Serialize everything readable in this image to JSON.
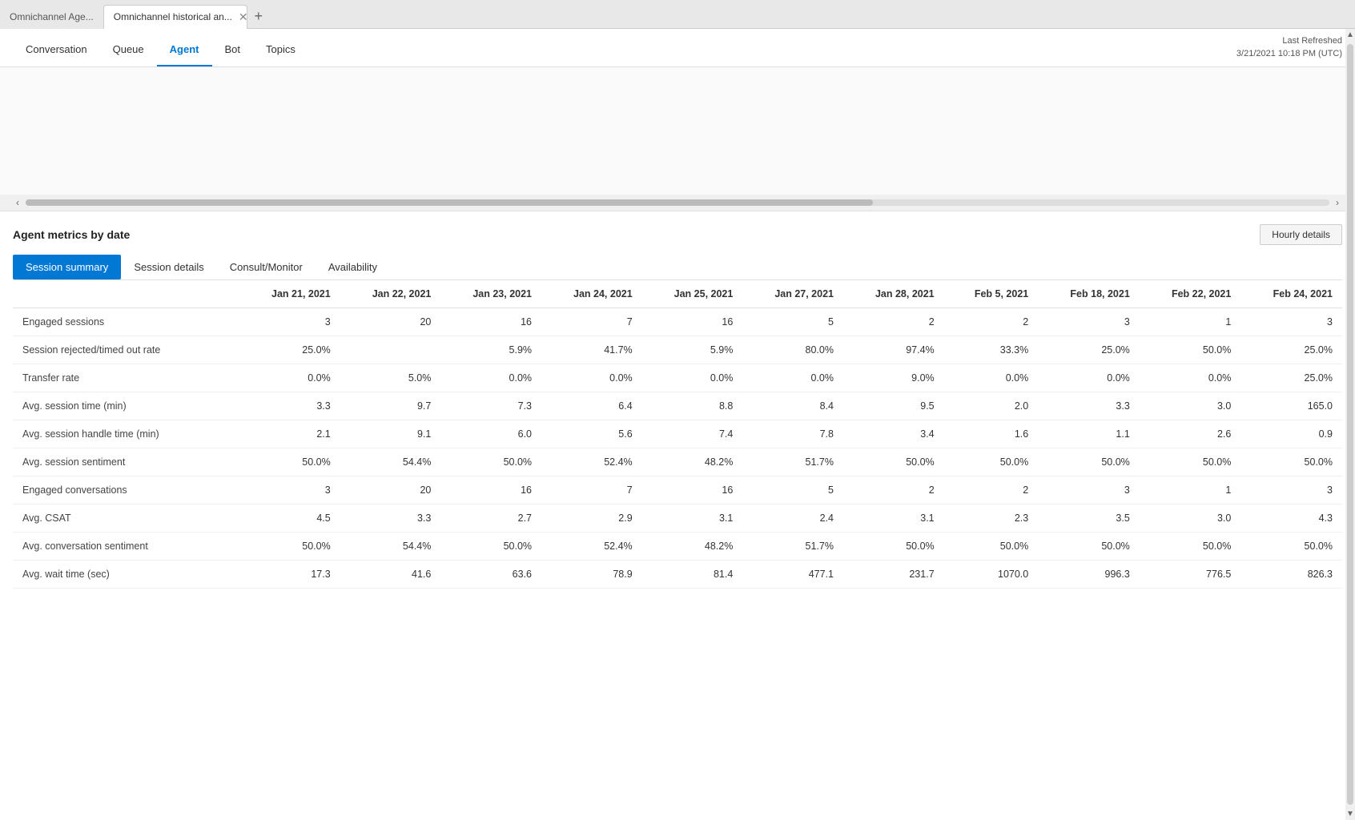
{
  "browser": {
    "tabs": [
      {
        "id": "tab1",
        "label": "Omnichannel Age...",
        "active": false
      },
      {
        "id": "tab2",
        "label": "Omnichannel historical an...",
        "active": true
      }
    ],
    "add_tab_label": "+"
  },
  "nav": {
    "items": [
      {
        "id": "conversation",
        "label": "Conversation",
        "active": false
      },
      {
        "id": "queue",
        "label": "Queue",
        "active": false
      },
      {
        "id": "agent",
        "label": "Agent",
        "active": true
      },
      {
        "id": "bot",
        "label": "Bot",
        "active": false
      },
      {
        "id": "topics",
        "label": "Topics",
        "active": false
      }
    ],
    "last_refreshed_label": "Last Refreshed",
    "last_refreshed_value": "3/21/2021 10:18 PM (UTC)"
  },
  "section": {
    "title": "Agent metrics by date",
    "hourly_details_button": "Hourly details",
    "sub_tabs": [
      {
        "id": "session-summary",
        "label": "Session summary",
        "active": true
      },
      {
        "id": "session-details",
        "label": "Session details",
        "active": false
      },
      {
        "id": "consult-monitor",
        "label": "Consult/Monitor",
        "active": false
      },
      {
        "id": "availability",
        "label": "Availability",
        "active": false
      }
    ]
  },
  "table": {
    "columns": [
      "",
      "Jan 21, 2021",
      "Jan 22, 2021",
      "Jan 23, 2021",
      "Jan 24, 2021",
      "Jan 25, 2021",
      "Jan 27, 2021",
      "Jan 28, 2021",
      "Feb 5, 2021",
      "Feb 18, 2021",
      "Feb 22, 2021",
      "Feb 24, 2021"
    ],
    "rows": [
      {
        "label": "Engaged sessions",
        "values": [
          "3",
          "20",
          "16",
          "7",
          "16",
          "5",
          "2",
          "2",
          "3",
          "1",
          "3"
        ]
      },
      {
        "label": "Session rejected/timed out rate",
        "values": [
          "25.0%",
          "",
          "5.9%",
          "41.7%",
          "5.9%",
          "80.0%",
          "97.4%",
          "33.3%",
          "25.0%",
          "50.0%",
          "25.0%"
        ]
      },
      {
        "label": "Transfer rate",
        "values": [
          "0.0%",
          "5.0%",
          "0.0%",
          "0.0%",
          "0.0%",
          "0.0%",
          "9.0%",
          "0.0%",
          "0.0%",
          "0.0%",
          "25.0%"
        ]
      },
      {
        "label": "Avg. session time (min)",
        "values": [
          "3.3",
          "9.7",
          "7.3",
          "6.4",
          "8.8",
          "8.4",
          "9.5",
          "2.0",
          "3.3",
          "3.0",
          "165.0"
        ]
      },
      {
        "label": "Avg. session handle time (min)",
        "values": [
          "2.1",
          "9.1",
          "6.0",
          "5.6",
          "7.4",
          "7.8",
          "3.4",
          "1.6",
          "1.1",
          "2.6",
          "0.9"
        ]
      },
      {
        "label": "Avg. session sentiment",
        "values": [
          "50.0%",
          "54.4%",
          "50.0%",
          "52.4%",
          "48.2%",
          "51.7%",
          "50.0%",
          "50.0%",
          "50.0%",
          "50.0%",
          "50.0%"
        ]
      },
      {
        "label": "Engaged conversations",
        "values": [
          "3",
          "20",
          "16",
          "7",
          "16",
          "5",
          "2",
          "2",
          "3",
          "1",
          "3"
        ]
      },
      {
        "label": "Avg. CSAT",
        "values": [
          "4.5",
          "3.3",
          "2.7",
          "2.9",
          "3.1",
          "2.4",
          "3.1",
          "2.3",
          "3.5",
          "3.0",
          "4.3"
        ]
      },
      {
        "label": "Avg. conversation sentiment",
        "values": [
          "50.0%",
          "54.4%",
          "50.0%",
          "52.4%",
          "48.2%",
          "51.7%",
          "50.0%",
          "50.0%",
          "50.0%",
          "50.0%",
          "50.0%"
        ]
      },
      {
        "label": "Avg. wait time (sec)",
        "values": [
          "17.3",
          "41.6",
          "63.6",
          "78.9",
          "81.4",
          "477.1",
          "231.7",
          "1070.0",
          "996.3",
          "776.5",
          "826.3"
        ]
      }
    ]
  },
  "colors": {
    "active_tab_bg": "#0078d4",
    "active_nav_color": "#0078d4",
    "active_nav_border": "#0078d4"
  }
}
